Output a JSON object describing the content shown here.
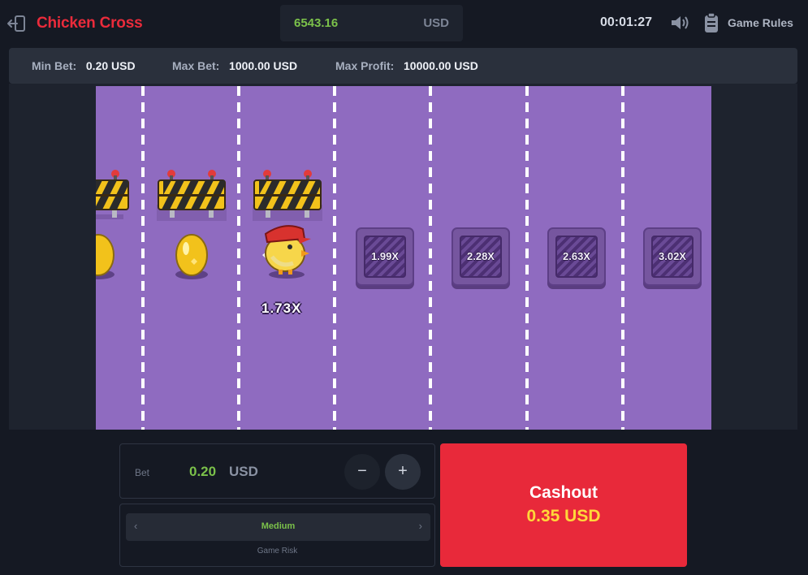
{
  "header": {
    "brand": "Chicken Cross",
    "balance": "6543.16",
    "balance_currency": "USD",
    "timer": "00:01:27",
    "rules_label": "Game Rules"
  },
  "limits": {
    "min_bet_label": "Min Bet:",
    "min_bet_value": "0.20 USD",
    "max_bet_label": "Max Bet:",
    "max_bet_value": "1000.00 USD",
    "max_profit_label": "Max Profit:",
    "max_profit_value": "10000.00 USD"
  },
  "board": {
    "current_multiplier": "1.73X",
    "next_tiles": [
      "1.99X",
      "2.28X",
      "2.63X",
      "3.02X"
    ]
  },
  "bet": {
    "label": "Bet",
    "value": "0.20",
    "currency": "USD",
    "minus": "−",
    "plus": "+"
  },
  "risk": {
    "value": "Medium",
    "label": "Game Risk",
    "prev": "‹",
    "next": "›"
  },
  "cashout": {
    "title": "Cashout",
    "amount": "0.35 USD"
  },
  "colors": {
    "brand_red": "#ea2b3b",
    "board_purple": "#8f6bc0",
    "balance_green": "#7bc14a",
    "cashout_red": "#e8293a",
    "cashout_amount_yellow": "#ffd83a"
  },
  "icons": {
    "back": "exit-arrow-icon",
    "sound": "speaker-icon",
    "rules": "clipboard-icon"
  }
}
